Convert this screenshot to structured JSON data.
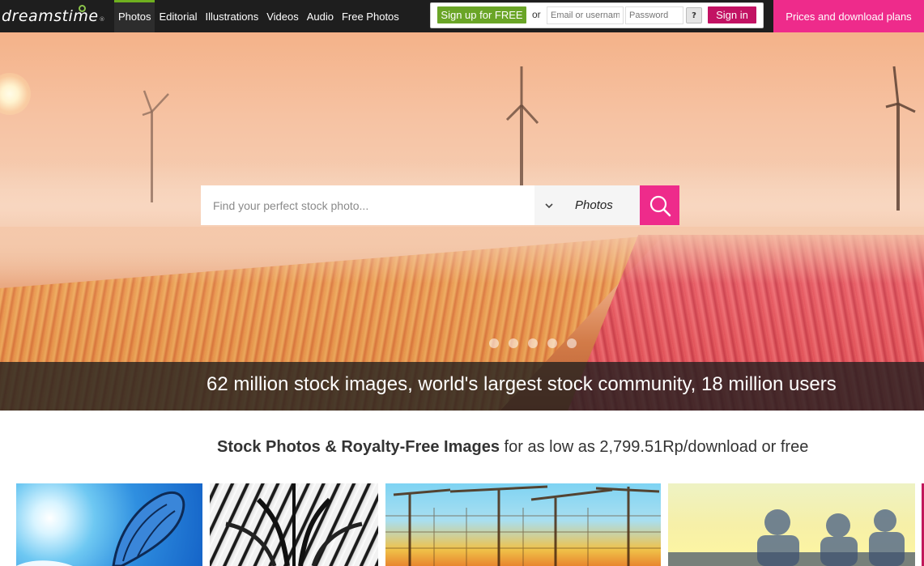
{
  "header": {
    "logo_text": "dreamstime",
    "logo_mark": "®",
    "nav": [
      {
        "label": "Photos",
        "active": true
      },
      {
        "label": "Editorial"
      },
      {
        "label": "Illustrations"
      },
      {
        "label": "Videos"
      },
      {
        "label": "Audio"
      },
      {
        "label": "Free Photos"
      }
    ],
    "signup_label": "Sign up for FREE",
    "or_text": "or",
    "username_placeholder": "Email or username",
    "password_placeholder": "Password",
    "help_label": "?",
    "signin_label": "Sign in",
    "pricing_label": "Prices and download plans"
  },
  "hero": {
    "search_placeholder": "Find your perfect stock photo...",
    "search_type": "Photos",
    "slide_count": 5,
    "tagline": "62 million stock images, world's largest stock community, 18 million users"
  },
  "headline": {
    "bold": "Stock Photos & Royalty-Free Images",
    "rest": "for as low as 2,799.51Rp/download or free"
  },
  "thumbnails": [
    {
      "name": "butterfly-thumbnail"
    },
    {
      "name": "tiger-thumbnail"
    },
    {
      "name": "construction-cranes-thumbnail"
    },
    {
      "name": "business-silhouettes-thumbnail"
    }
  ],
  "colors": {
    "brand_green": "#6aa527",
    "brand_magenta": "#c21263",
    "accent_pink": "#ee2b8b",
    "nav_bg": "#1e1e1e"
  }
}
